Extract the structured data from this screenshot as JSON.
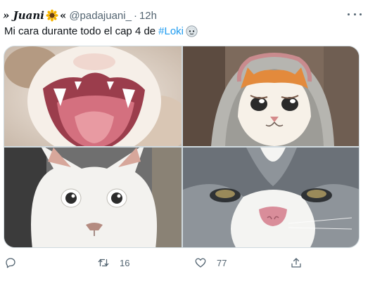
{
  "tweet": {
    "display_name": "» Juani",
    "name_suffix": "«",
    "handle": "@padajuani_",
    "separator": "·",
    "time": "12h",
    "text_prefix": "Mi cara durante todo el cap 4 de",
    "hashtag": "#Loki",
    "emojis": [
      "sunflower-emoji",
      "loki-face-emoji"
    ],
    "media": [
      {
        "description_icon": "screaming-cat-image"
      },
      {
        "description_icon": "crying-cat-in-blanket-image"
      },
      {
        "description_icon": "wide-eyed-white-cat-image"
      },
      {
        "description_icon": "grey-cat-closeup-image"
      }
    ],
    "actions": {
      "reply_count": "",
      "retweet_count": "16",
      "like_count": "77"
    }
  },
  "colors": {
    "text": "#0f1419",
    "secondary": "#536471",
    "link": "#1d9bf0"
  }
}
